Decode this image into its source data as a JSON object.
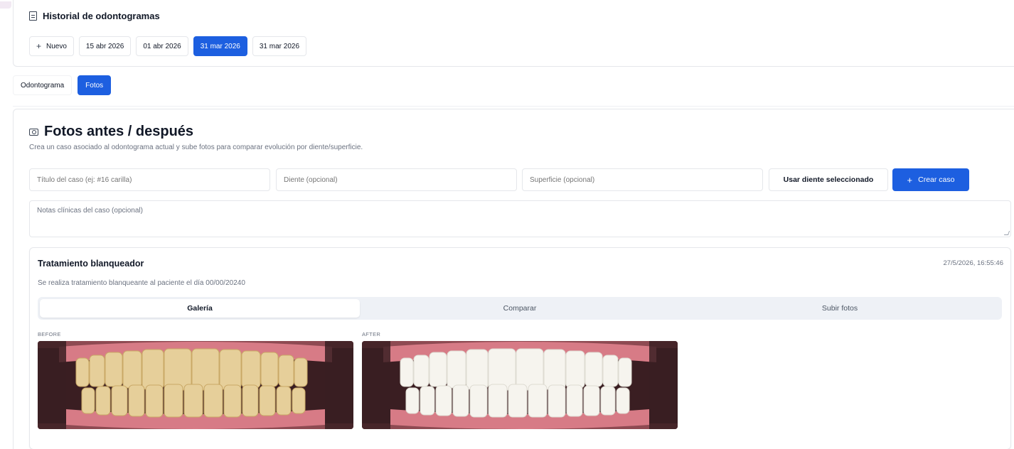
{
  "history": {
    "title": "Historial de odontogramas",
    "new_label": "Nuevo",
    "dates": [
      "15 abr 2026",
      "01 abr 2026",
      "31 mar 2026",
      "31 mar 2026"
    ],
    "active_date_index": 2
  },
  "view_tabs": [
    {
      "label": "Odontograma",
      "active": false
    },
    {
      "label": "Fotos",
      "active": true
    }
  ],
  "photos": {
    "title": "Fotos antes / después",
    "subtitle": "Crea un caso asociado al odontograma actual y sube fotos para comparar evolución por diente/superficie.",
    "form": {
      "title_placeholder": "Título del caso (ej: #16 carilla)",
      "tooth_placeholder": "Diente (opcional)",
      "surface_placeholder": "Superficie (opcional)",
      "use_tooth_label": "Usar diente seleccionado",
      "create_label": "Crear caso",
      "notes_placeholder": "Notas clínicas del caso (opcional)"
    },
    "case": {
      "title": "Tratamiento blanqueador",
      "timestamp": "27/5/2026, 16:55:46",
      "description": "Se realiza tratamiento blanqueante al paciente el día 00/00/20240",
      "tabs": [
        {
          "label": "Galería",
          "active": true
        },
        {
          "label": "Comparar",
          "active": false
        },
        {
          "label": "Subir fotos",
          "active": false
        }
      ],
      "before_label": "BEFORE",
      "after_label": "AFTER"
    }
  },
  "colors": {
    "accent": "#1d5fe0",
    "before_teeth": "#e6cf9a",
    "after_teeth": "#f6f4ee",
    "gum": "#d77b86",
    "mouth_dark": "#3a1e22"
  },
  "icons": {
    "history": "document-icon",
    "photos": "camera-icon",
    "add": "plus-icon"
  }
}
